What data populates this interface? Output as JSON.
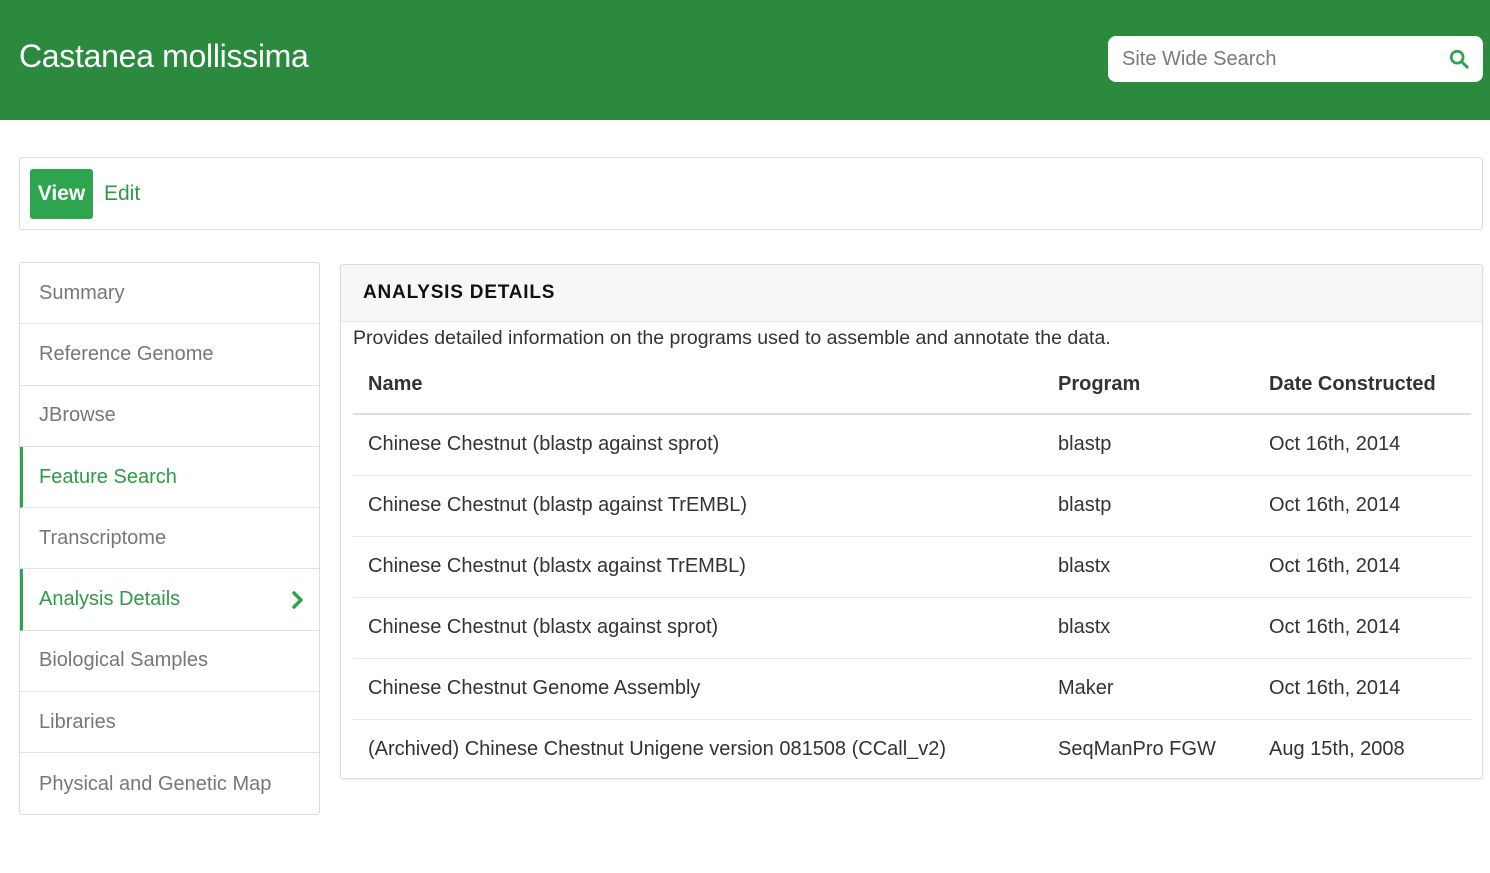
{
  "header": {
    "site_title": "Castanea mollissima",
    "search_placeholder": "Site Wide Search",
    "search_value": ""
  },
  "tabs": {
    "view_label": "View",
    "edit_label": "Edit"
  },
  "sidebar": {
    "items": [
      {
        "label": "Summary",
        "active": false
      },
      {
        "label": "Reference Genome",
        "active": false
      },
      {
        "label": "JBrowse",
        "active": false
      },
      {
        "label": "Feature Search",
        "active": false
      },
      {
        "label": "Transcriptome",
        "active": false
      },
      {
        "label": "Analysis Details",
        "active": true
      },
      {
        "label": "Biological Samples",
        "active": false
      },
      {
        "label": "Libraries",
        "active": false
      },
      {
        "label": "Physical and Genetic Map",
        "active": false
      }
    ]
  },
  "panel": {
    "title": "ANALYSIS DETAILS",
    "description": "Provides detailed information on the programs used to assemble and annotate the data.",
    "columns": [
      "Name",
      "Program",
      "Date Constructed"
    ],
    "rows": [
      {
        "name": "Chinese Chestnut (blastp against sprot)",
        "program": "blastp",
        "date": "Oct 16th, 2014"
      },
      {
        "name": "Chinese Chestnut (blastp against TrEMBL)",
        "program": "blastp",
        "date": "Oct 16th, 2014"
      },
      {
        "name": "Chinese Chestnut (blastx against TrEMBL)",
        "program": "blastx",
        "date": "Oct 16th, 2014"
      },
      {
        "name": "Chinese Chestnut (blastx against sprot)",
        "program": "blastx",
        "date": "Oct 16th, 2014"
      },
      {
        "name": "Chinese Chestnut Genome Assembly",
        "program": "Maker",
        "date": "Oct 16th, 2014"
      },
      {
        "name": "(Archived) Chinese Chestnut Unigene version 081508 (CCall_v2)",
        "program": "SeqManPro FGW",
        "date": "Aug 15th, 2008"
      }
    ]
  },
  "colors": {
    "header_bg": "#2b8a3e",
    "accent": "#2ea44f",
    "link": "#2e9a46"
  },
  "icons": {
    "search": "search-icon",
    "active_item_indicator": "chevron-right-icon"
  }
}
